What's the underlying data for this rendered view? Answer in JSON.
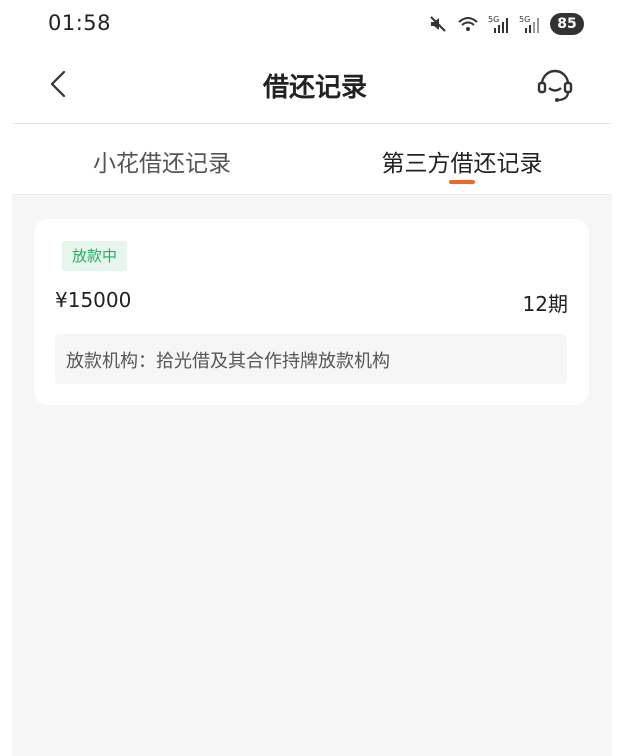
{
  "status_bar": {
    "time": "01:58",
    "battery": "85",
    "icons": [
      "mute-icon",
      "wifi-icon",
      "signal-5g-icon",
      "signal-5g-icon",
      "battery-icon"
    ]
  },
  "nav": {
    "title": "借还记录",
    "back_icon": "chevron-left-icon",
    "support_icon": "headset-icon"
  },
  "tabs": [
    {
      "label": "小花借还记录",
      "active": false
    },
    {
      "label": "第三方借还记录",
      "active": true
    }
  ],
  "records": [
    {
      "status": "放款中",
      "amount": "¥15000",
      "term": "12期",
      "institution": "放款机构：拾光借及其合作持牌放款机构"
    }
  ],
  "colors": {
    "accent": "#ec6a24",
    "status_green": "#27ae60",
    "status_bg": "#e6f6ec",
    "page_bg": "#f6f6f6"
  }
}
